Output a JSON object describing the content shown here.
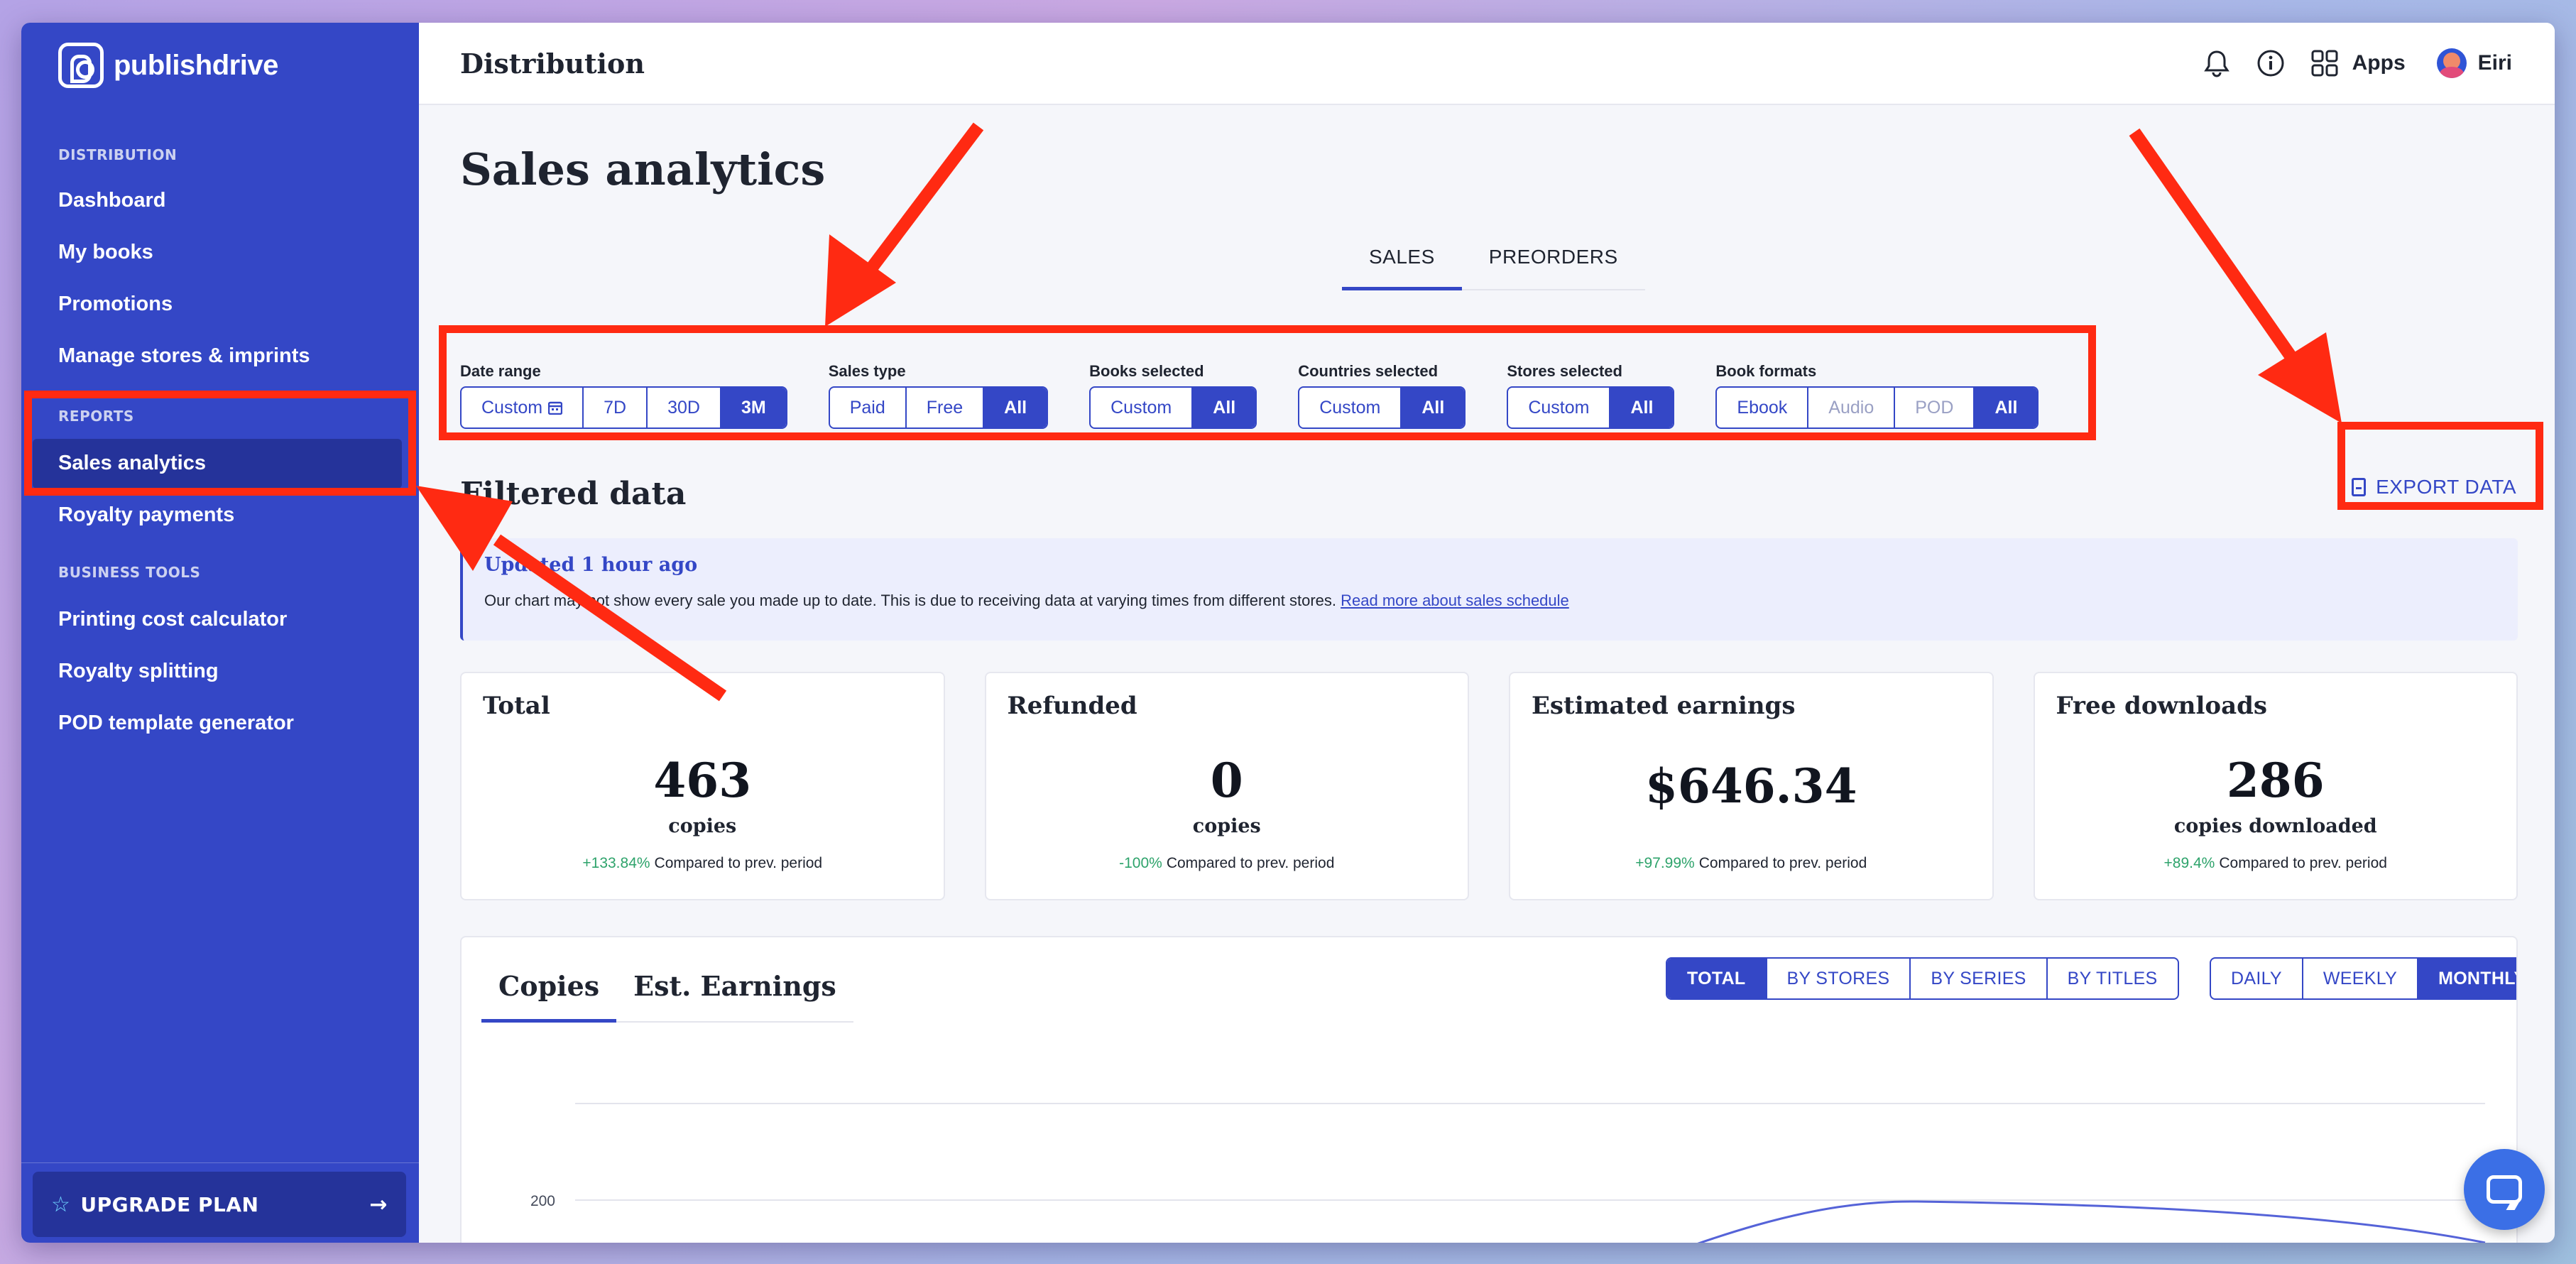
{
  "brand": {
    "name": "publishdrive"
  },
  "sidebar": {
    "sections": [
      {
        "title": "DISTRIBUTION"
      },
      {
        "title": "REPORTS"
      },
      {
        "title": "BUSINESS TOOLS"
      }
    ],
    "items": [
      {
        "label": "Dashboard"
      },
      {
        "label": "My books"
      },
      {
        "label": "Promotions"
      },
      {
        "label": "Manage stores & imprints"
      },
      {
        "label": "Sales analytics",
        "active": true
      },
      {
        "label": "Royalty payments"
      },
      {
        "label": "Printing cost calculator"
      },
      {
        "label": "Royalty splitting"
      },
      {
        "label": "POD template generator"
      }
    ],
    "upgrade_label": "UPGRADE PLAN"
  },
  "topbar": {
    "title": "Distribution",
    "apps_label": "Apps",
    "user_name": "Eiri",
    "icons": [
      "bell-icon",
      "info-icon",
      "apps-grid-icon"
    ]
  },
  "page": {
    "title": "Sales analytics",
    "tabs": [
      {
        "label": "SALES",
        "active": true
      },
      {
        "label": "PREORDERS"
      }
    ]
  },
  "filters": [
    {
      "label": "Date range",
      "options": [
        "Custom",
        "7D",
        "30D",
        "3M"
      ],
      "selected": "3M"
    },
    {
      "label": "Sales type",
      "options": [
        "Paid",
        "Free",
        "All"
      ],
      "selected": "All"
    },
    {
      "label": "Books selected",
      "options": [
        "Custom",
        "All"
      ],
      "selected": "All"
    },
    {
      "label": "Countries selected",
      "options": [
        "Custom",
        "All"
      ],
      "selected": "All"
    },
    {
      "label": "Stores selected",
      "options": [
        "Custom",
        "All"
      ],
      "selected": "All"
    },
    {
      "label": "Book formats",
      "options": [
        "Ebook",
        "Audio",
        "POD",
        "All"
      ],
      "selected": "All"
    }
  ],
  "filtered": {
    "title": "Filtered data",
    "export_label": "EXPORT DATA",
    "notice_title": "Updated 1 hour ago",
    "notice_text": "Our chart may not show every sale you made up to date. This is due to receiving data at varying times from different stores.",
    "notice_link": "Read more about sales schedule"
  },
  "cards": [
    {
      "title": "Total",
      "value": "463",
      "unit": "copies",
      "change": "+133.84%",
      "compare": "Compared to prev. period"
    },
    {
      "title": "Refunded",
      "value": "0",
      "unit": "copies",
      "change": "-100%",
      "compare": "Compared to prev. period"
    },
    {
      "title": "Estimated earnings",
      "value": "$646.34",
      "unit": "",
      "change": "+97.99%",
      "compare": "Compared to prev. period"
    },
    {
      "title": "Free downloads",
      "value": "286",
      "unit": "copies downloaded",
      "change": "+89.4%",
      "compare": "Compared to prev. period"
    }
  ],
  "chart": {
    "tabs": [
      {
        "label": "Copies",
        "active": true
      },
      {
        "label": "Est. Earnings"
      }
    ],
    "group_options": [
      "TOTAL",
      "BY STORES",
      "BY SERIES",
      "BY TITLES"
    ],
    "group_selected": "TOTAL",
    "period_options": [
      "DAILY",
      "WEEKLY",
      "MONTHLY"
    ],
    "period_selected": "MONTHLY"
  },
  "chart_data": {
    "type": "line",
    "title": "",
    "xlabel": "",
    "ylabel": "",
    "y_ticks": [
      200
    ],
    "series": [
      {
        "values": []
      }
    ],
    "grid": true
  },
  "colors": {
    "sidebar": "#3447c6",
    "accent": "#3447c6",
    "positive": "#2ea36b",
    "annotation": "#ff2a12"
  }
}
